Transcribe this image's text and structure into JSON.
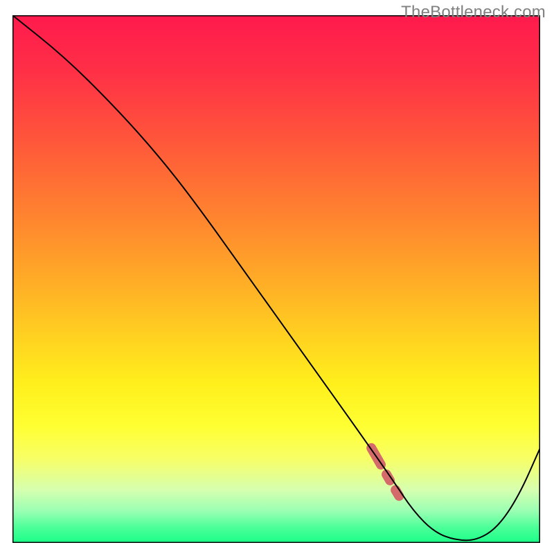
{
  "watermark": "TheBottleneck.com",
  "colors": {
    "watermark": "#808080",
    "gradient_stops": [
      {
        "offset": 0.0,
        "color": "#ff1a4d"
      },
      {
        "offset": 0.1,
        "color": "#ff2e47"
      },
      {
        "offset": 0.2,
        "color": "#ff4b3e"
      },
      {
        "offset": 0.3,
        "color": "#ff6a35"
      },
      {
        "offset": 0.4,
        "color": "#ff8a2e"
      },
      {
        "offset": 0.5,
        "color": "#ffab27"
      },
      {
        "offset": 0.6,
        "color": "#ffce21"
      },
      {
        "offset": 0.7,
        "color": "#fff01c"
      },
      {
        "offset": 0.78,
        "color": "#ffff33"
      },
      {
        "offset": 0.84,
        "color": "#f8ff66"
      },
      {
        "offset": 0.9,
        "color": "#d6ffb0"
      },
      {
        "offset": 0.94,
        "color": "#99ffb3"
      },
      {
        "offset": 0.97,
        "color": "#4dff99"
      },
      {
        "offset": 1.0,
        "color": "#1aff88"
      }
    ],
    "curve": "#000000",
    "dashed_marker": "#d56a6a",
    "frame": "#000000"
  },
  "chart_data": {
    "type": "line",
    "title": "",
    "xlabel": "",
    "ylabel": "",
    "xlim": [
      0,
      100
    ],
    "ylim": [
      0,
      100
    ],
    "grid": false,
    "series": [
      {
        "name": "bottleneck-curve",
        "x": [
          0,
          10,
          20,
          28,
          35,
          45,
          55,
          65,
          72,
          76,
          80,
          84,
          88,
          92,
          96,
          100
        ],
        "y": [
          100,
          92,
          82,
          73,
          64,
          50,
          36,
          22,
          12,
          6,
          2,
          0.5,
          0.5,
          3,
          9,
          18
        ]
      }
    ],
    "dashed_segment": {
      "name": "highlight-dash",
      "x": [
        68,
        72,
        75,
        78,
        80,
        82,
        84,
        86
      ],
      "y": [
        18,
        11,
        6,
        3,
        1.5,
        0.8,
        0.6,
        0.6
      ]
    }
  }
}
